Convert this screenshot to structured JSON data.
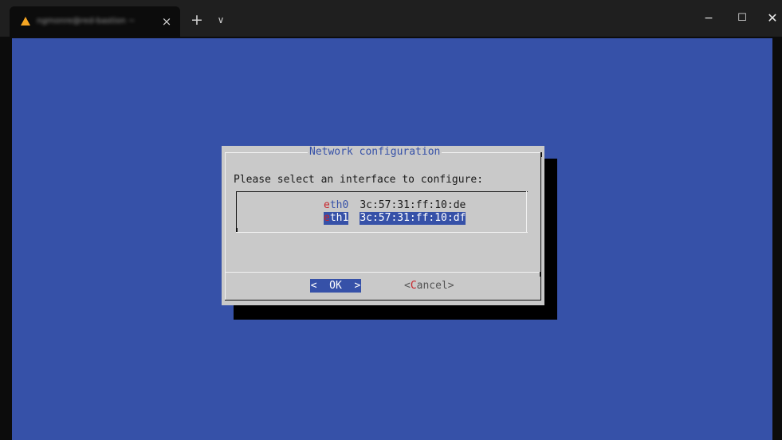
{
  "window": {
    "tab_title": "ngmonre@red-bastion ~",
    "tab_close_icon": "×",
    "new_tab_icon": "+",
    "tab_dropdown_icon": "∨",
    "minimize_icon": "−",
    "maximize_icon": "☐",
    "close_icon": "✕"
  },
  "dialog": {
    "title": "Network configuration",
    "prompt": "Please select an interface to configure:",
    "items": [
      {
        "tag_hot": "e",
        "tag_rest": "th0",
        "description": "3c:57:31:ff:10:de",
        "selected": false
      },
      {
        "tag_hot": "e",
        "tag_rest": "th1",
        "description": "3c:57:31:ff:10:df",
        "selected": true
      }
    ],
    "buttons": {
      "ok_label": "<  OK  >",
      "cancel_open": "<",
      "cancel_hot": "C",
      "cancel_rest": "ancel",
      "cancel_close": ">"
    }
  },
  "colors": {
    "screen_background": "#3651a8",
    "dialog_background": "#c9c9c9",
    "highlight": "#3651a8",
    "hotkey": "#c8242a"
  }
}
